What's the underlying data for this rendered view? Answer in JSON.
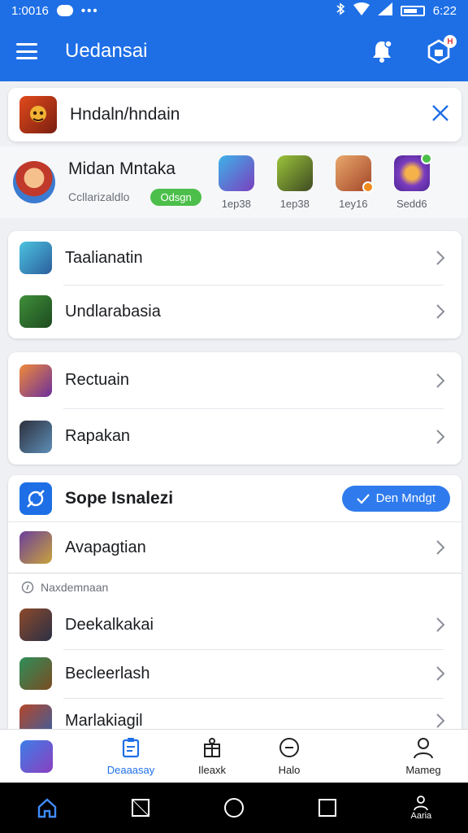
{
  "status_bar": {
    "time": "1:0016",
    "clock": "6:22"
  },
  "app_bar": {
    "title": "Uedansai",
    "notification_badge": "H"
  },
  "search": {
    "query": "Hndaln/hndain"
  },
  "profile": {
    "name": "Midan Mntaka",
    "subtitle": "Ccllarizaldlo",
    "status_label": "Odsgn",
    "apps": [
      {
        "label": "1ep38",
        "icon": "hero-game-icon"
      },
      {
        "label": "1ep38",
        "icon": "orc-game-icon"
      },
      {
        "label": "1ey16",
        "icon": "cowboy-game-icon"
      },
      {
        "label": "Sedd6",
        "icon": "magic-orb-icon"
      }
    ]
  },
  "group1": [
    {
      "label": "Taalianatin",
      "icon": "wizard-game-icon"
    },
    {
      "label": "Undlarabasia",
      "icon": "elf-game-icon"
    }
  ],
  "group2": [
    {
      "label": "Rectuain",
      "icon": "sorceress-game-icon"
    },
    {
      "label": "Rapakan",
      "icon": "hero-girl-game-icon"
    }
  ],
  "section": {
    "title": "Sope Isnalezi",
    "action_label": "Den Mndgt",
    "first_item": {
      "label": "Avapagtian",
      "icon": "goblin-game-icon"
    },
    "sub_label": "Naxdemnaan",
    "items": [
      {
        "label": "Deekalkakai",
        "icon": "knight-game-icon"
      },
      {
        "label": "Becleerlash",
        "icon": "steampunk-game-icon"
      },
      {
        "label": "Marlakiagil",
        "icon": "warrior-game-icon"
      }
    ]
  },
  "tabs": [
    {
      "label": ""
    },
    {
      "label": "Deaaasay"
    },
    {
      "label": "Ileaxk"
    },
    {
      "label": "Halo"
    },
    {
      "label": "Mameg"
    }
  ],
  "nav": {
    "profile_label": "Aaria"
  },
  "colors": {
    "primary": "#1e6fe6",
    "status_green": "#4cbf4b"
  }
}
